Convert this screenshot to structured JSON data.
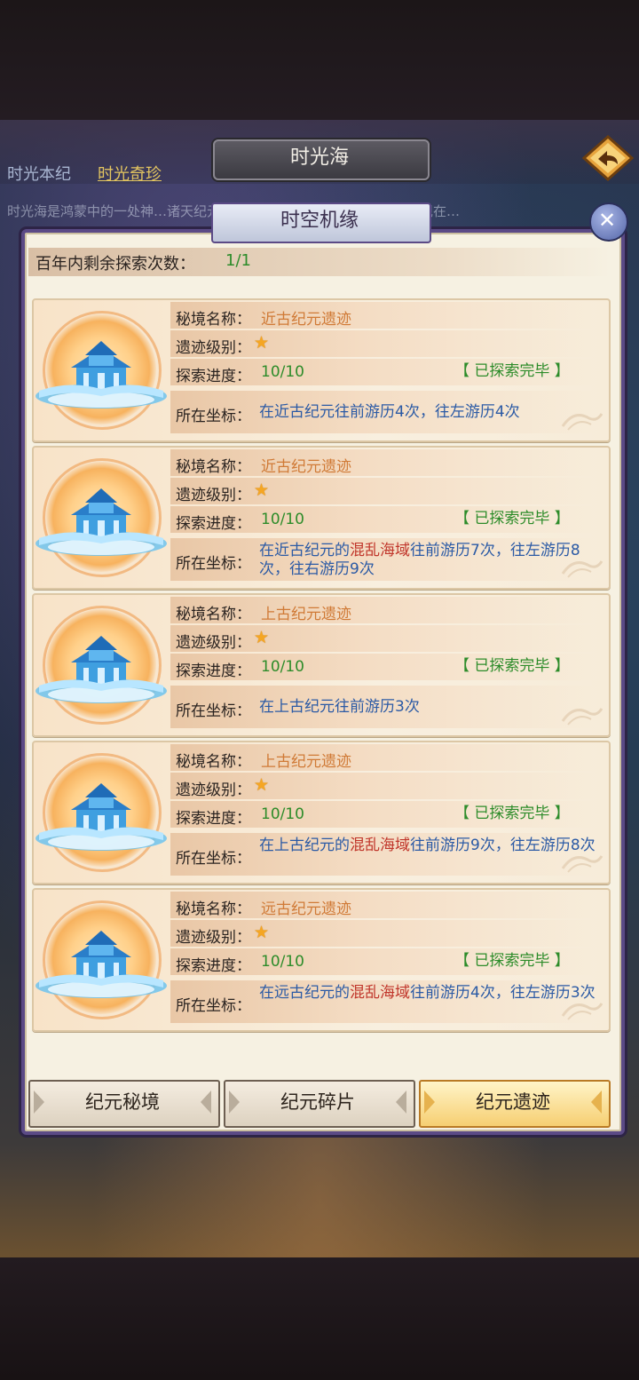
{
  "scene": {
    "title": "时光海",
    "tabs": [
      "时光本纪",
      "时光奇珍"
    ],
    "description": "时光海是鸿蒙中的一处神…诸天纪元，时光法则……落的一角起源，将现在…"
  },
  "modal": {
    "title": "时空机缘",
    "remaining_label": "百年内剩余探索次数：",
    "remaining_value": "1/1",
    "labels": {
      "name": "秘境名称：",
      "level": "遗迹级别：",
      "progress": "探索进度：",
      "coord": "所在坐标："
    },
    "cards": [
      {
        "name": "近古纪元遗迹",
        "stars": 1,
        "progress": "10/10",
        "status": "【 已探索完毕 】",
        "coord_parts": [
          {
            "t": "在近古纪元往前游历4次，往左游历4次"
          }
        ]
      },
      {
        "name": "近古纪元遗迹",
        "stars": 1,
        "progress": "10/10",
        "status": "【 已探索完毕 】",
        "coord_parts": [
          {
            "t": "在近古纪元的"
          },
          {
            "t": "混乱海域",
            "hl": true
          },
          {
            "t": "往前游历7次，往左游历8次，往右游历9次"
          }
        ]
      },
      {
        "name": "上古纪元遗迹",
        "stars": 1,
        "progress": "10/10",
        "status": "【 已探索完毕 】",
        "coord_parts": [
          {
            "t": "在上古纪元往前游历3次"
          }
        ]
      },
      {
        "name": "上古纪元遗迹",
        "stars": 1,
        "progress": "10/10",
        "status": "【 已探索完毕 】",
        "coord_parts": [
          {
            "t": "在上古纪元的"
          },
          {
            "t": "混乱海域",
            "hl": true
          },
          {
            "t": "往前游历9次，往左游历8次"
          }
        ]
      },
      {
        "name": "远古纪元遗迹",
        "stars": 1,
        "progress": "10/10",
        "status": "【 已探索完毕 】",
        "coord_parts": [
          {
            "t": "在远古纪元的"
          },
          {
            "t": "混乱海域",
            "hl": true
          },
          {
            "t": "往前游历4次，往左游历3次"
          }
        ]
      }
    ],
    "bottom_tabs": [
      {
        "label": "纪元秘境",
        "active": false
      },
      {
        "label": "纪元碎片",
        "active": false
      },
      {
        "label": "纪元遗迹",
        "active": true
      }
    ]
  },
  "colors": {
    "name_orange": "#d07a36",
    "progress_green": "#2d8c2a",
    "coord_blue": "#2b5aa5",
    "highlight_red": "#c0352a",
    "frame_purple": "#5b4a86"
  },
  "icons": [
    "back-arrow-icon",
    "close-icon",
    "star-icon",
    "palace-icon"
  ]
}
